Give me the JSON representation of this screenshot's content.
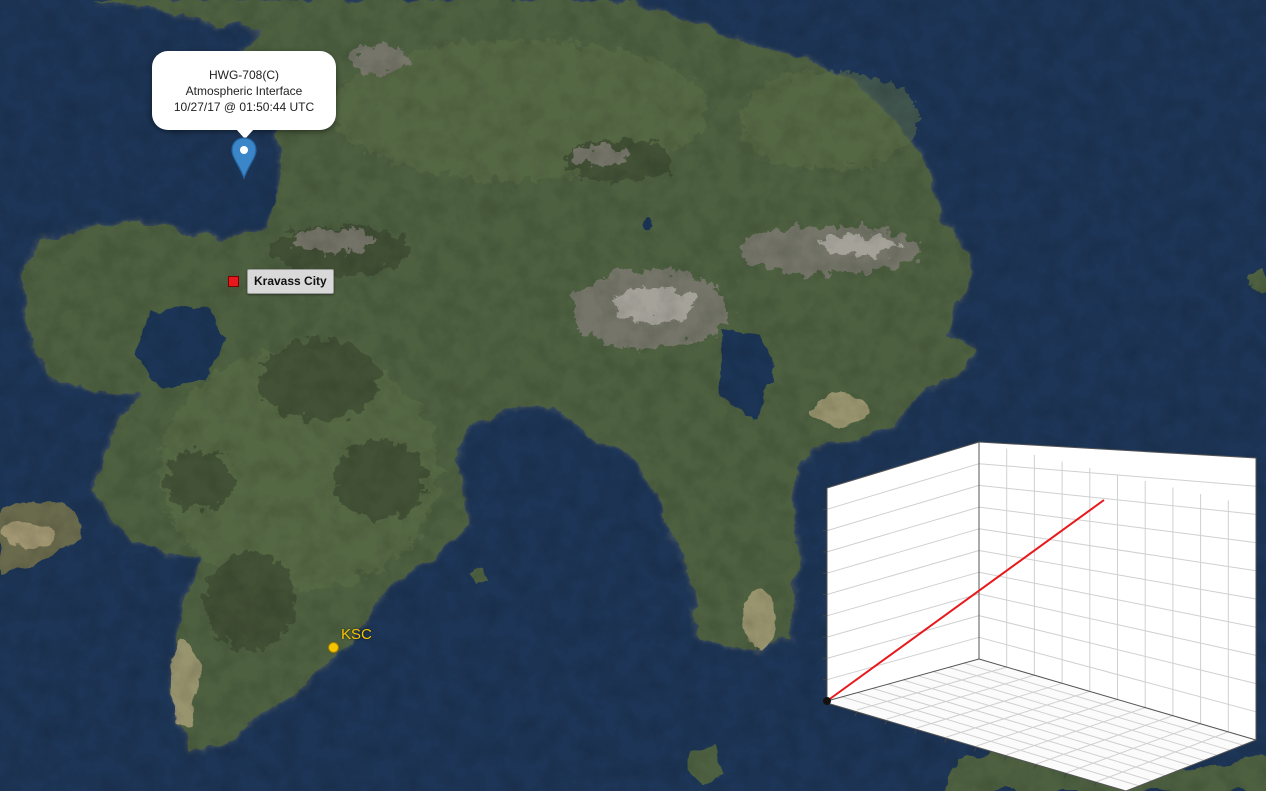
{
  "map": {
    "colors": {
      "ocean": "#1d3556",
      "land": "#4d6040",
      "land_dark": "#3a4a2e",
      "mountain": "#7d7a70",
      "beach": "#b9ab82"
    },
    "marker": {
      "icon": "map-pin-icon",
      "color": "#3a86c8",
      "popup_lines": [
        "HWG-708(C)",
        "Atmospheric Interface",
        "10/27/17 @ 01:50:44 UTC"
      ]
    },
    "labels": {
      "city": {
        "name": "Kravass City",
        "color": "#e8191c"
      },
      "site": {
        "name": "KSC",
        "color": "#f5c400"
      }
    }
  },
  "chart_data": {
    "type": "line",
    "dimensions": 3,
    "grid": true,
    "series": [
      {
        "color": "#e8191c",
        "points": [
          [
            0,
            0,
            0
          ],
          [
            1,
            0,
            1
          ]
        ]
      }
    ],
    "start_marker_color": "#111111"
  }
}
